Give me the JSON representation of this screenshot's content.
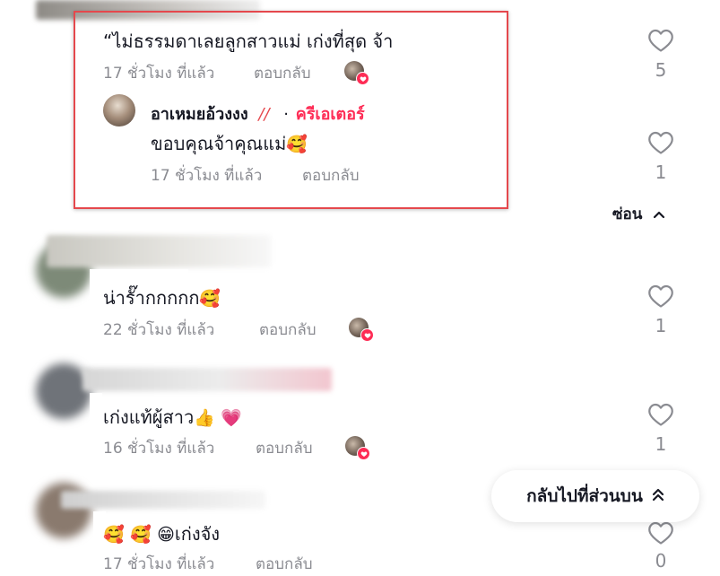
{
  "comments": [
    {
      "text": "“ไม่ธรรมดาเลยลูกสาวแม่ เก่งที่สุด จ้า",
      "time": "17 ชั่วโมง ที่แล้ว",
      "reply_label": "ตอบกลับ",
      "likes": "5",
      "creator_liked": true,
      "replies": [
        {
          "username": "อาเหมยอ้วงงง",
          "username_suffix": "//",
          "badge_separator": "·",
          "badge": "ครีเอเตอร์",
          "text": "ขอบคุณจ้าคุณแม่",
          "emoji": "🥰",
          "time": "17 ชั่วโมง ที่แล้ว",
          "reply_label": "ตอบกลับ",
          "likes": "1"
        }
      ],
      "hide_replies_label": "ซ่อน"
    },
    {
      "text": "น่ารั๊ากกกกก",
      "emoji": "🥰",
      "time": "22 ชั่วโมง ที่แล้ว",
      "reply_label": "ตอบกลับ",
      "likes": "1",
      "creator_liked": true
    },
    {
      "text": "เก่งแท้ผู้สาว",
      "emoji": "👍",
      "emoji2": "💗",
      "time": "16 ชั่วโมง ที่แล้ว",
      "reply_label": "ตอบกลับ",
      "likes": "1",
      "creator_liked": true
    },
    {
      "emoji": "🥰",
      "emoji2": "🥰",
      "emoji3": "😁",
      "text": "เก่งจัง",
      "time": "17 ชั่วโมง ที่แล้ว",
      "reply_label": "ตอบกลับ",
      "likes": "0"
    }
  ],
  "back_to_top_label": "กลับไปที่ส่วนบน",
  "colors": {
    "accent": "#fe2c55",
    "highlight_border": "#e5484d",
    "secondary_text": "#8a8b91"
  },
  "icons": [
    "heart-outline-icon",
    "chevron-up-icon",
    "double-chevron-up-icon",
    "creator-liked-heart-icon"
  ]
}
